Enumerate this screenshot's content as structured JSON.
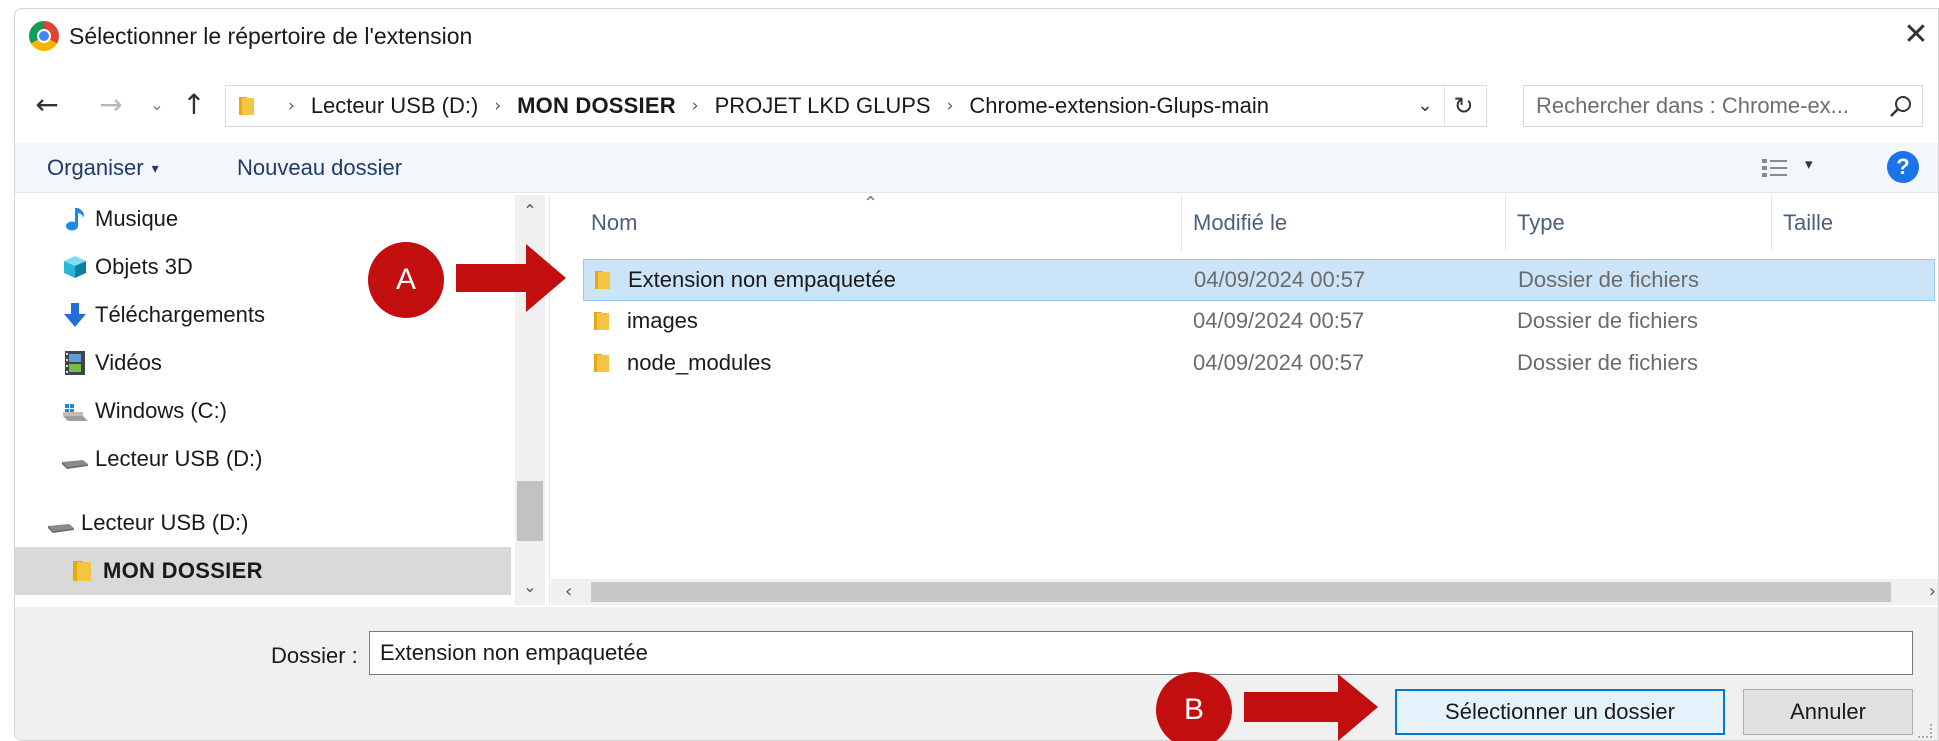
{
  "window": {
    "title": "Sélectionner le répertoire de l'extension",
    "close_glyph": "✕"
  },
  "nav": {
    "back_glyph": "←",
    "forward_glyph": "→",
    "recent_glyph": "⌄",
    "up_glyph": "↑"
  },
  "address": {
    "crumbs": [
      "Lecteur USB (D:)",
      "MON DOSSIER",
      "PROJET LKD GLUPS",
      "Chrome-extension-Glups-main"
    ],
    "separator": "›",
    "dropdown_glyph": "⌄",
    "refresh_glyph": "↻"
  },
  "search": {
    "placeholder": "Rechercher dans : Chrome-ex..."
  },
  "toolbar": {
    "organise_label": "Organiser",
    "caret_glyph": "▾",
    "new_folder_label": "Nouveau dossier",
    "help_label": "?"
  },
  "sidebar": {
    "items": [
      {
        "label": "Musique",
        "icon": "music-note-icon"
      },
      {
        "label": "Objets 3D",
        "icon": "cube-3d-icon"
      },
      {
        "label": "Téléchargements",
        "icon": "download-arrow-icon"
      },
      {
        "label": "Vidéos",
        "icon": "video-film-icon"
      },
      {
        "label": "Windows (C:)",
        "icon": "windows-drive-icon"
      },
      {
        "label": "Lecteur USB (D:)",
        "icon": "usb-drive-icon"
      },
      {
        "label": "Lecteur USB (D:)",
        "icon": "usb-drive-icon"
      },
      {
        "label": "MON DOSSIER",
        "icon": "folder-icon"
      }
    ],
    "scroll_up_glyph": "⌃",
    "scroll_down_glyph": "⌄"
  },
  "filelist": {
    "columns": [
      "Nom",
      "Modifié le",
      "Type",
      "Taille"
    ],
    "sort_glyph": "⌃",
    "rows": [
      {
        "name": "Extension non empaquetée",
        "modified": "04/09/2024 00:57",
        "type": "Dossier de fichiers",
        "selected": true
      },
      {
        "name": "images",
        "modified": "04/09/2024 00:57",
        "type": "Dossier de fichiers",
        "selected": false
      },
      {
        "name": "node_modules",
        "modified": "04/09/2024 00:57",
        "type": "Dossier de fichiers",
        "selected": false
      }
    ],
    "hscroll_left_glyph": "‹",
    "hscroll_right_glyph": "›"
  },
  "footer": {
    "folder_label": "Dossier :",
    "folder_value": "Extension non empaquetée",
    "select_button": "Sélectionner un dossier",
    "cancel_button": "Annuler"
  },
  "annotations": {
    "a_label": "A",
    "b_label": "B",
    "color": "#c20e0e"
  },
  "colors": {
    "selection": "#cce4f7",
    "accent": "#0078d7",
    "folder": "#f5c542",
    "help": "#1a73e8"
  }
}
